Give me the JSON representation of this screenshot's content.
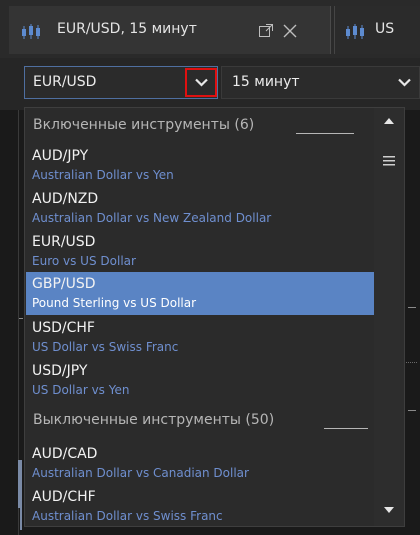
{
  "tabs": [
    {
      "label": "EUR/USD, 15 минут",
      "icon": "candlestick-chart-icon",
      "active": true
    },
    {
      "label": "US",
      "icon": "candlestick-chart-icon",
      "active": false
    }
  ],
  "selector": {
    "symbol_value": "EUR/USD",
    "period_value": "15 минут"
  },
  "dropdown": {
    "enabled_group": {
      "title": "Включенные инструменты (6)"
    },
    "enabled_items": [
      {
        "symbol": "AUD/JPY",
        "description": "Australian Dollar vs Yen",
        "selected": false
      },
      {
        "symbol": "AUD/NZD",
        "description": "Australian Dollar vs New Zealand Dollar",
        "selected": false
      },
      {
        "symbol": "EUR/USD",
        "description": "Euro vs US Dollar",
        "selected": false
      },
      {
        "symbol": "GBP/USD",
        "description": "Pound Sterling vs US Dollar",
        "selected": true
      },
      {
        "symbol": "USD/CHF",
        "description": "US Dollar vs Swiss Franc",
        "selected": false
      },
      {
        "symbol": "USD/JPY",
        "description": "US Dollar vs Yen",
        "selected": false
      }
    ],
    "disabled_group": {
      "title": "Выключенные инструменты (50)"
    },
    "disabled_items": [
      {
        "symbol": "AUD/CAD",
        "description": "Australian Dollar vs Canadian Dollar",
        "selected": false
      },
      {
        "symbol": "AUD/CHF",
        "description": "Australian Dollar vs Swiss Franc",
        "selected": false
      }
    ]
  },
  "colors": {
    "accent": "#5a84c4",
    "highlight_border": "#e01010",
    "description_text": "#6f8fcf"
  }
}
